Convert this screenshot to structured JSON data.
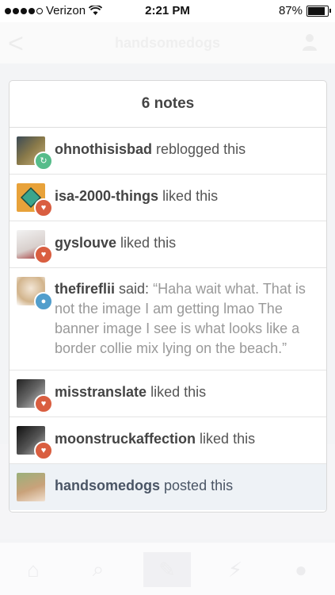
{
  "status": {
    "carrier": "Verizon",
    "time": "2:21 PM",
    "battery": "87%",
    "battery_level": 0.87
  },
  "nav": {
    "back_glyph": "<",
    "title": "handsomedogs"
  },
  "notes": {
    "title": "6 notes",
    "items": [
      {
        "name": "ohnothisisbad",
        "action": "reblogged this",
        "type": "reblog"
      },
      {
        "name": "isa-2000-things",
        "action": "liked this",
        "type": "like"
      },
      {
        "name": "gyslouve",
        "action": "liked this",
        "type": "like"
      },
      {
        "name": "thefireflii",
        "action": "said:",
        "quote": "“Haha wait what. That is not the image I am getting lmao The banner image I see is what looks like a border collie mix lying on the beach.”",
        "type": "reply"
      },
      {
        "name": "misstranslate",
        "action": "liked this",
        "type": "like"
      },
      {
        "name": "moonstruckaffection",
        "action": "liked this",
        "type": "like"
      },
      {
        "name": "handsomedogs",
        "action": "posted this",
        "type": "post"
      }
    ]
  },
  "tabbar": {
    "icons": [
      "home-icon",
      "search-icon",
      "compose-icon",
      "activity-icon",
      "account-icon"
    ]
  },
  "colors": {
    "like": "#d95e40",
    "reblog": "#56bc8a",
    "reply": "#529ecc",
    "posted_row_bg": "#eef2f6"
  }
}
